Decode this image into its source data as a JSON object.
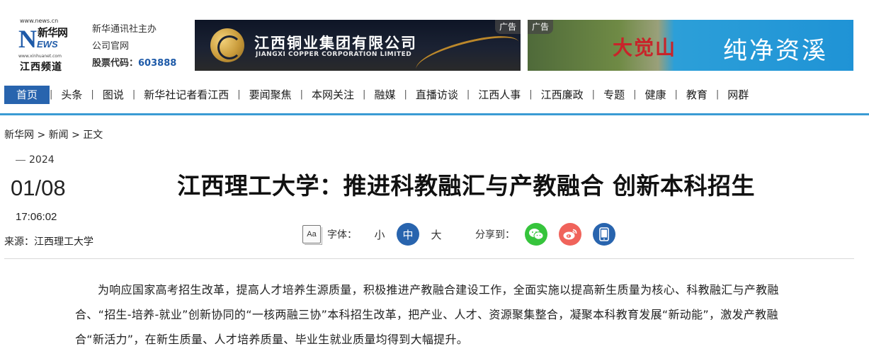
{
  "header": {
    "logo": {
      "url_top": "www.news.cn",
      "brand_cn": "新华网",
      "brand_en_initial": "N",
      "brand_en_rest": "EWS",
      "url_bottom": "www.xinhuanet.com",
      "channel": "江西频道"
    },
    "org": {
      "line1": "新华通讯社主办",
      "line2": "公司官网",
      "stock_label": "股票代码：",
      "stock_code": "603888"
    },
    "ads": [
      {
        "tag": "广告",
        "company_cn": "江西铜业集团有限公司",
        "company_en": "JIANGXI COPPER CORPORATION LIMITED"
      },
      {
        "tag": "广告",
        "scenic_name": "大觉山",
        "slogan": "纯净资溪"
      }
    ]
  },
  "nav": {
    "items": [
      {
        "label": "首页",
        "active": true
      },
      {
        "label": "头条"
      },
      {
        "label": "图说"
      },
      {
        "label": "新华社记者看江西"
      },
      {
        "label": "要闻聚焦"
      },
      {
        "label": "本网关注"
      },
      {
        "label": "融媒"
      },
      {
        "label": "直播访谈"
      },
      {
        "label": "江西人事"
      },
      {
        "label": "江西廉政"
      },
      {
        "label": "专题"
      },
      {
        "label": "健康"
      },
      {
        "label": "教育"
      },
      {
        "label": "网群"
      }
    ],
    "separator": "|"
  },
  "breadcrumb": "新华网 > 新闻 > 正文",
  "meta": {
    "year": "2024",
    "date": "01/08",
    "time": "17:06:02",
    "source": "来源：江西理工大学"
  },
  "article": {
    "title": "江西理工大学：推进科教融汇与产教融合 创新本科招生",
    "body": "为响应国家高考招生改革，提高人才培养生源质量，积极推进产教融合建设工作，全面实施以提高新生质量为核心、科教融汇与产教融合、“招生-培养-就业”创新协同的“一核两融三协”本科招生改革，把产业、人才、资源聚集整合，凝聚本科教育发展“新动能”，激发产教融合“新活力”，在新生质量、人才培养质量、毕业生就业质量均得到大幅提升。"
  },
  "toolbar": {
    "font_icon_text": "Aa",
    "font_label": "字体：",
    "size_small": "小",
    "size_medium": "中",
    "size_large": "大",
    "share_label": "分享到：",
    "share_icons": [
      "wechat-icon",
      "weibo-icon",
      "mobile-icon"
    ]
  },
  "colors": {
    "nav_active_bg": "#2864ae",
    "nav_underline": "#3a9bd4",
    "stock_code": "#1e5aa8",
    "wechat": "#36c43c",
    "weibo": "#f0635b",
    "mobile": "#2864ae"
  }
}
